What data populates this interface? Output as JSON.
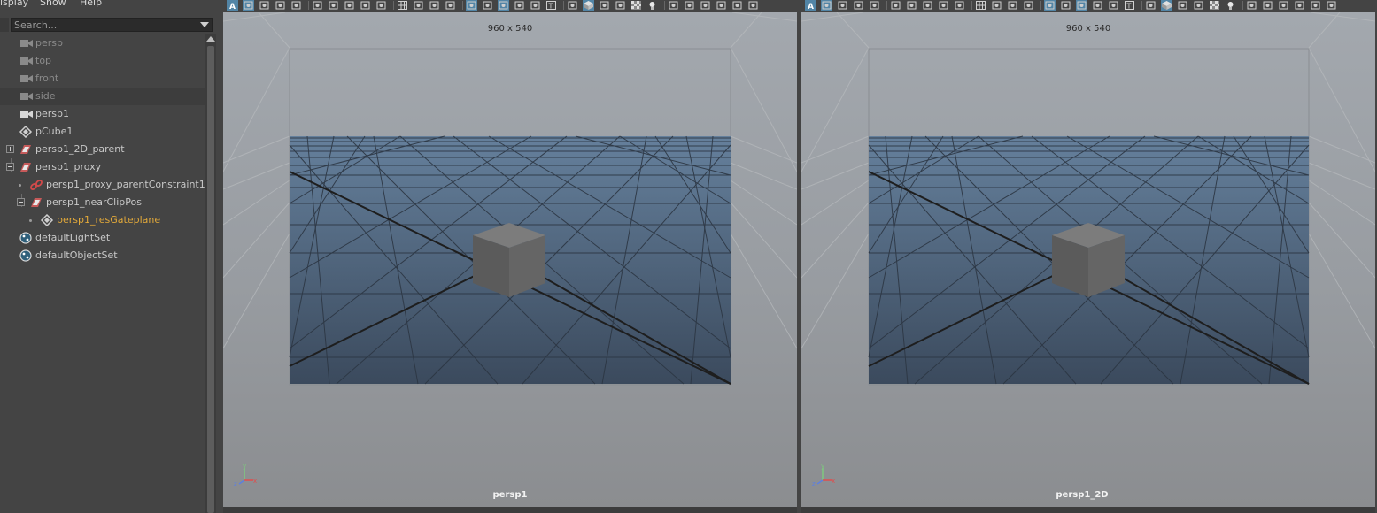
{
  "outliner": {
    "menu": [
      "isplay",
      "Show",
      "Help"
    ],
    "search_placeholder": "Search...",
    "items": [
      {
        "label": "persp",
        "icon": "camera-icon",
        "state": "hidden"
      },
      {
        "label": "top",
        "icon": "camera-icon",
        "state": "hidden"
      },
      {
        "label": "front",
        "icon": "camera-icon",
        "state": "hidden"
      },
      {
        "label": "side",
        "icon": "camera-icon",
        "state": "hidden"
      },
      {
        "label": "persp1",
        "icon": "camera-icon",
        "state": "normal"
      },
      {
        "label": "pCube1",
        "icon": "mesh-icon",
        "state": "normal"
      },
      {
        "label": "persp1_2D_parent",
        "icon": "transform-icon",
        "state": "normal"
      },
      {
        "label": "persp1_proxy",
        "icon": "transform-icon",
        "state": "normal"
      },
      {
        "label": "persp1_proxy_parentConstraint1",
        "icon": "constraint-icon",
        "state": "normal"
      },
      {
        "label": "persp1_nearClipPos",
        "icon": "transform-icon",
        "state": "normal"
      },
      {
        "label": "persp1_resGateplane",
        "icon": "mesh-icon",
        "state": "highlighted"
      },
      {
        "label": "defaultLightSet",
        "icon": "set-icon",
        "state": "normal"
      },
      {
        "label": "defaultObjectSet",
        "icon": "set-icon",
        "state": "normal"
      }
    ]
  },
  "viewports": [
    {
      "camera": "persp1",
      "resolution": "960 x 540"
    },
    {
      "camera": "persp1_2D",
      "resolution": "960 x 540"
    }
  ],
  "colors": {
    "highlight_text": "#e2a93a",
    "active_toolbar_button": "#5285a6",
    "gate_fill_top": "#65809c",
    "gate_fill_bottom": "#3b4a5d"
  }
}
